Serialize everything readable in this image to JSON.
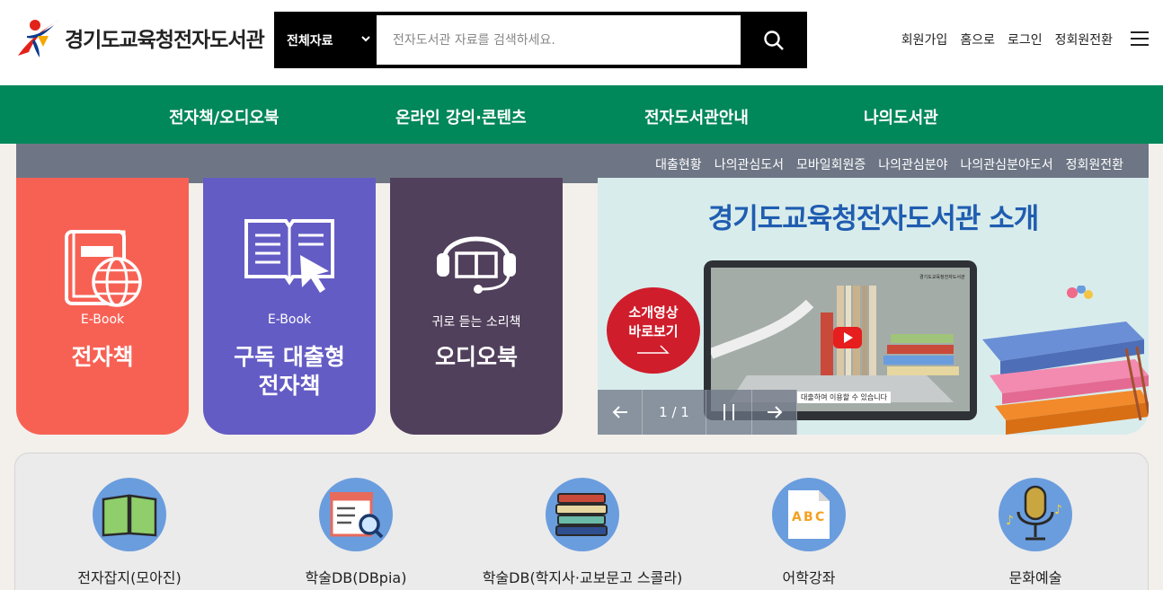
{
  "header": {
    "logo_text": "경기도교육청전자도서관",
    "search": {
      "category": "전체자료",
      "placeholder": "전자도서관 자료를 검색하세요."
    },
    "links": [
      "회원가입",
      "홈으로",
      "로그인",
      "정회원전환"
    ]
  },
  "gnb": [
    "전자책/오디오북",
    "온라인 강의·콘텐츠",
    "전자도서관안내",
    "나의도서관"
  ],
  "subnav": [
    "대출현황",
    "나의관심도서",
    "모바일회원증",
    "나의관심분야",
    "나의관심분야도서",
    "정회원전환"
  ],
  "cards": [
    {
      "sub": "E-Book",
      "main": "전자책",
      "color": "#f76154"
    },
    {
      "sub": "E-Book",
      "main": "구독 대출형\n전자책",
      "color": "#645cc5"
    },
    {
      "sub": "귀로 듣는 소리책",
      "main": "오디오북",
      "color": "#51405c"
    }
  ],
  "banner": {
    "title": "경기도교육청전자도서관 소개",
    "video_line1": "소개영상",
    "video_line2": "바로보기",
    "tablet_logo": "경기도교육청전자도서관",
    "caption": "대출하여 이용할 수 있습니다",
    "pager": "1 / 1"
  },
  "services": [
    {
      "label": "전자잡지(모아진)",
      "icon": "magazine-icon"
    },
    {
      "label": "학술DB(DBpia)",
      "icon": "database-search-icon"
    },
    {
      "label": "학술DB(학지사·교보문고 스콜라)",
      "icon": "books-stack-icon"
    },
    {
      "label": "어학강좌",
      "icon": "abc-icon"
    },
    {
      "label": "문화예술",
      "icon": "microphone-icon"
    }
  ],
  "colors": {
    "green": "#00875a",
    "subnav": "#6e7685",
    "service_circle": "#6a9dde"
  }
}
